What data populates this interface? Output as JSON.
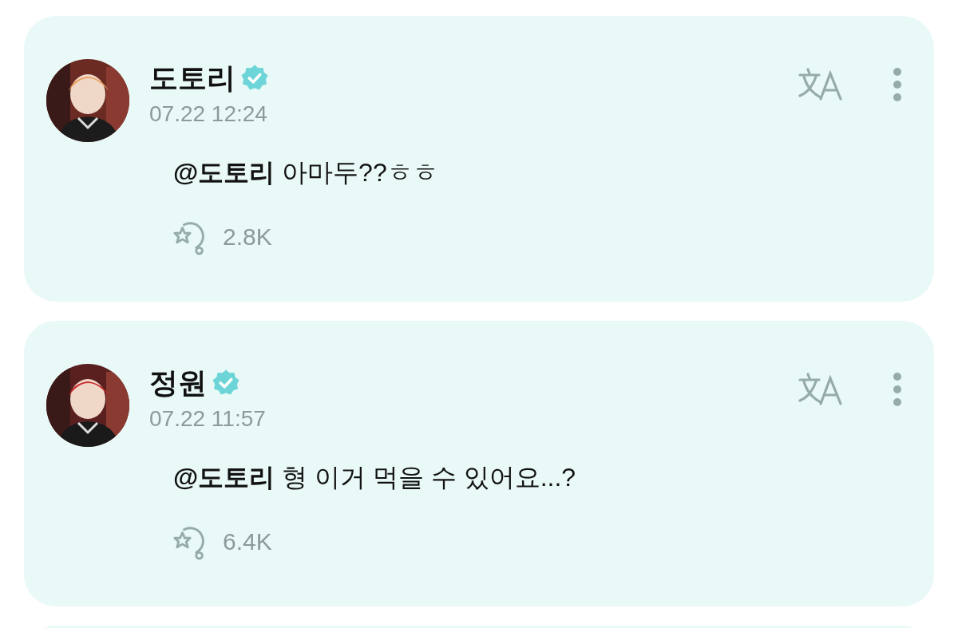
{
  "posts": [
    {
      "author": "도토리",
      "verified": true,
      "time": "07.22 12:24",
      "message": "**@도토리** 아마두??ㅎㅎ",
      "count": "2.8K"
    },
    {
      "author": "정원",
      "verified": true,
      "time": "07.22 11:57",
      "message": "**@도토리** 형 이거 먹을 수 있어요...?",
      "count": "6.4K"
    }
  ]
}
